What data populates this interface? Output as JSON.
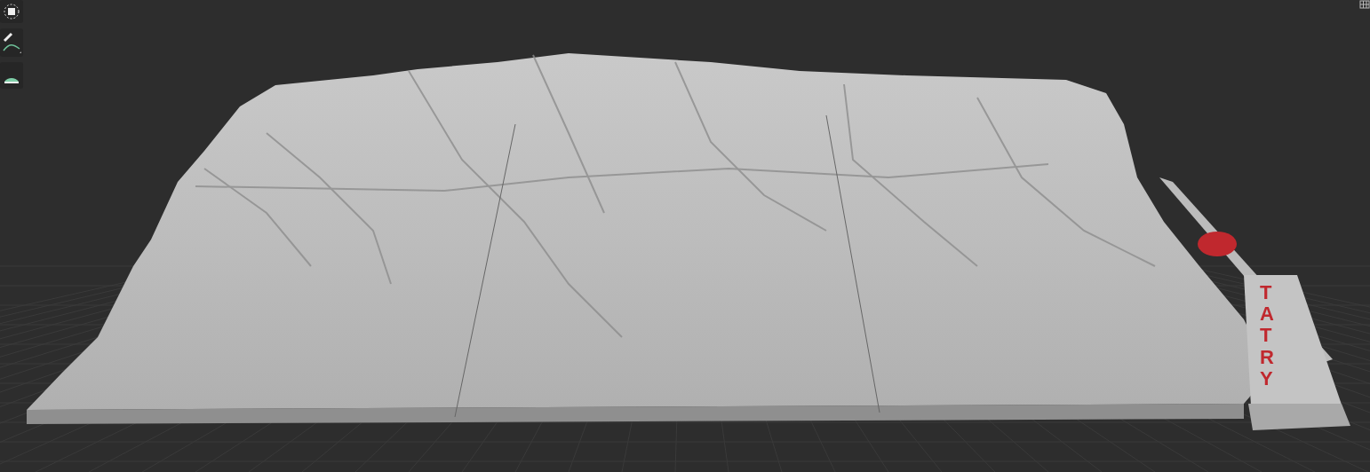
{
  "toolbar": {
    "tools": [
      {
        "kind": "move"
      },
      {
        "kind": "draw"
      },
      {
        "kind": "measure"
      }
    ]
  },
  "model": {
    "label": "TATRY"
  }
}
